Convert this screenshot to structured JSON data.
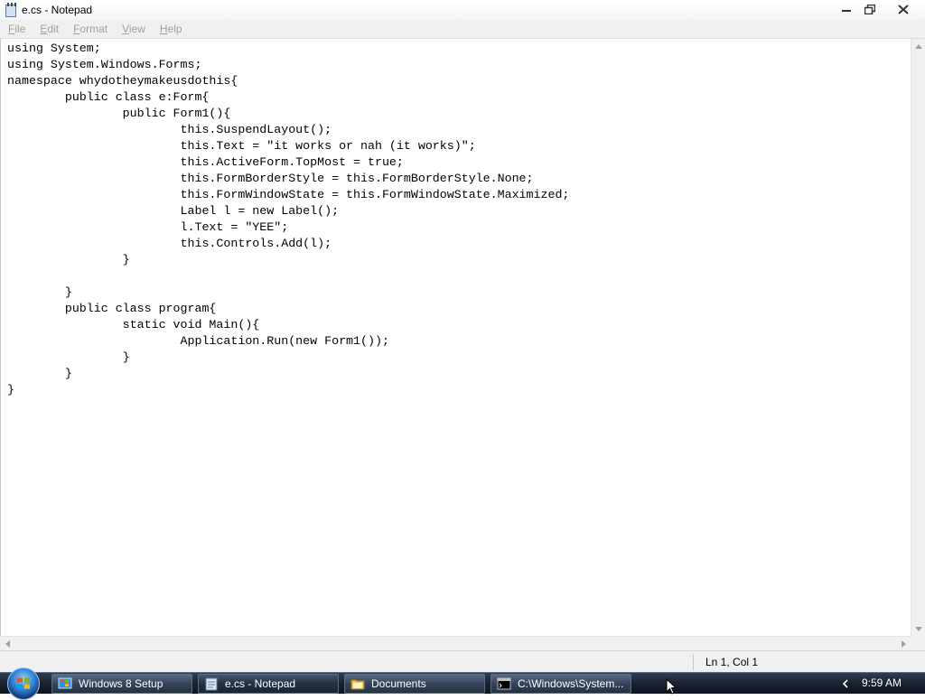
{
  "window": {
    "title": "e.cs - Notepad"
  },
  "menu": {
    "items": [
      {
        "first": "F",
        "rest": "ile"
      },
      {
        "first": "E",
        "rest": "dit"
      },
      {
        "first": "F",
        "rest": "ormat"
      },
      {
        "first": "V",
        "rest": "iew"
      },
      {
        "first": "H",
        "rest": "elp"
      }
    ]
  },
  "editor": {
    "content": "using System;\nusing System.Windows.Forms;\nnamespace whydotheymakeusdothis{\n\tpublic class e:Form{\n\t\tpublic Form1(){\n\t\t\tthis.SuspendLayout();\n\t\t\tthis.Text = \"it works or nah (it works)\";\n\t\t\tthis.ActiveForm.TopMost = true;\n\t\t\tthis.FormBorderStyle = this.FormBorderStyle.None;\n\t\t\tthis.FormWindowState = this.FormWindowState.Maximized;\n\t\t\tLabel l = new Label();\n\t\t\tl.Text = \"YEE\";\n\t\t\tthis.Controls.Add(l);\n\t\t}\n\n\t}\n\tpublic class program{\n\t\tstatic void Main(){\n\t\t\tApplication.Run(new Form1());\n\t\t}\n\t}\n}"
  },
  "status": {
    "position": "Ln 1, Col 1"
  },
  "taskbar": {
    "buttons": [
      {
        "label": "Windows 8 Setup",
        "icon": "setup-icon"
      },
      {
        "label": "e.cs - Notepad",
        "icon": "notepad-icon"
      },
      {
        "label": "Documents",
        "icon": "folder-icon"
      },
      {
        "label": "C:\\Windows\\System...",
        "icon": "cmd-icon"
      }
    ],
    "clock": "9:59 AM"
  },
  "colors": {
    "taskbar": "#1a2433",
    "menu_disabled_text": "#a0a0a0",
    "chrome": "#f0f0f0"
  }
}
